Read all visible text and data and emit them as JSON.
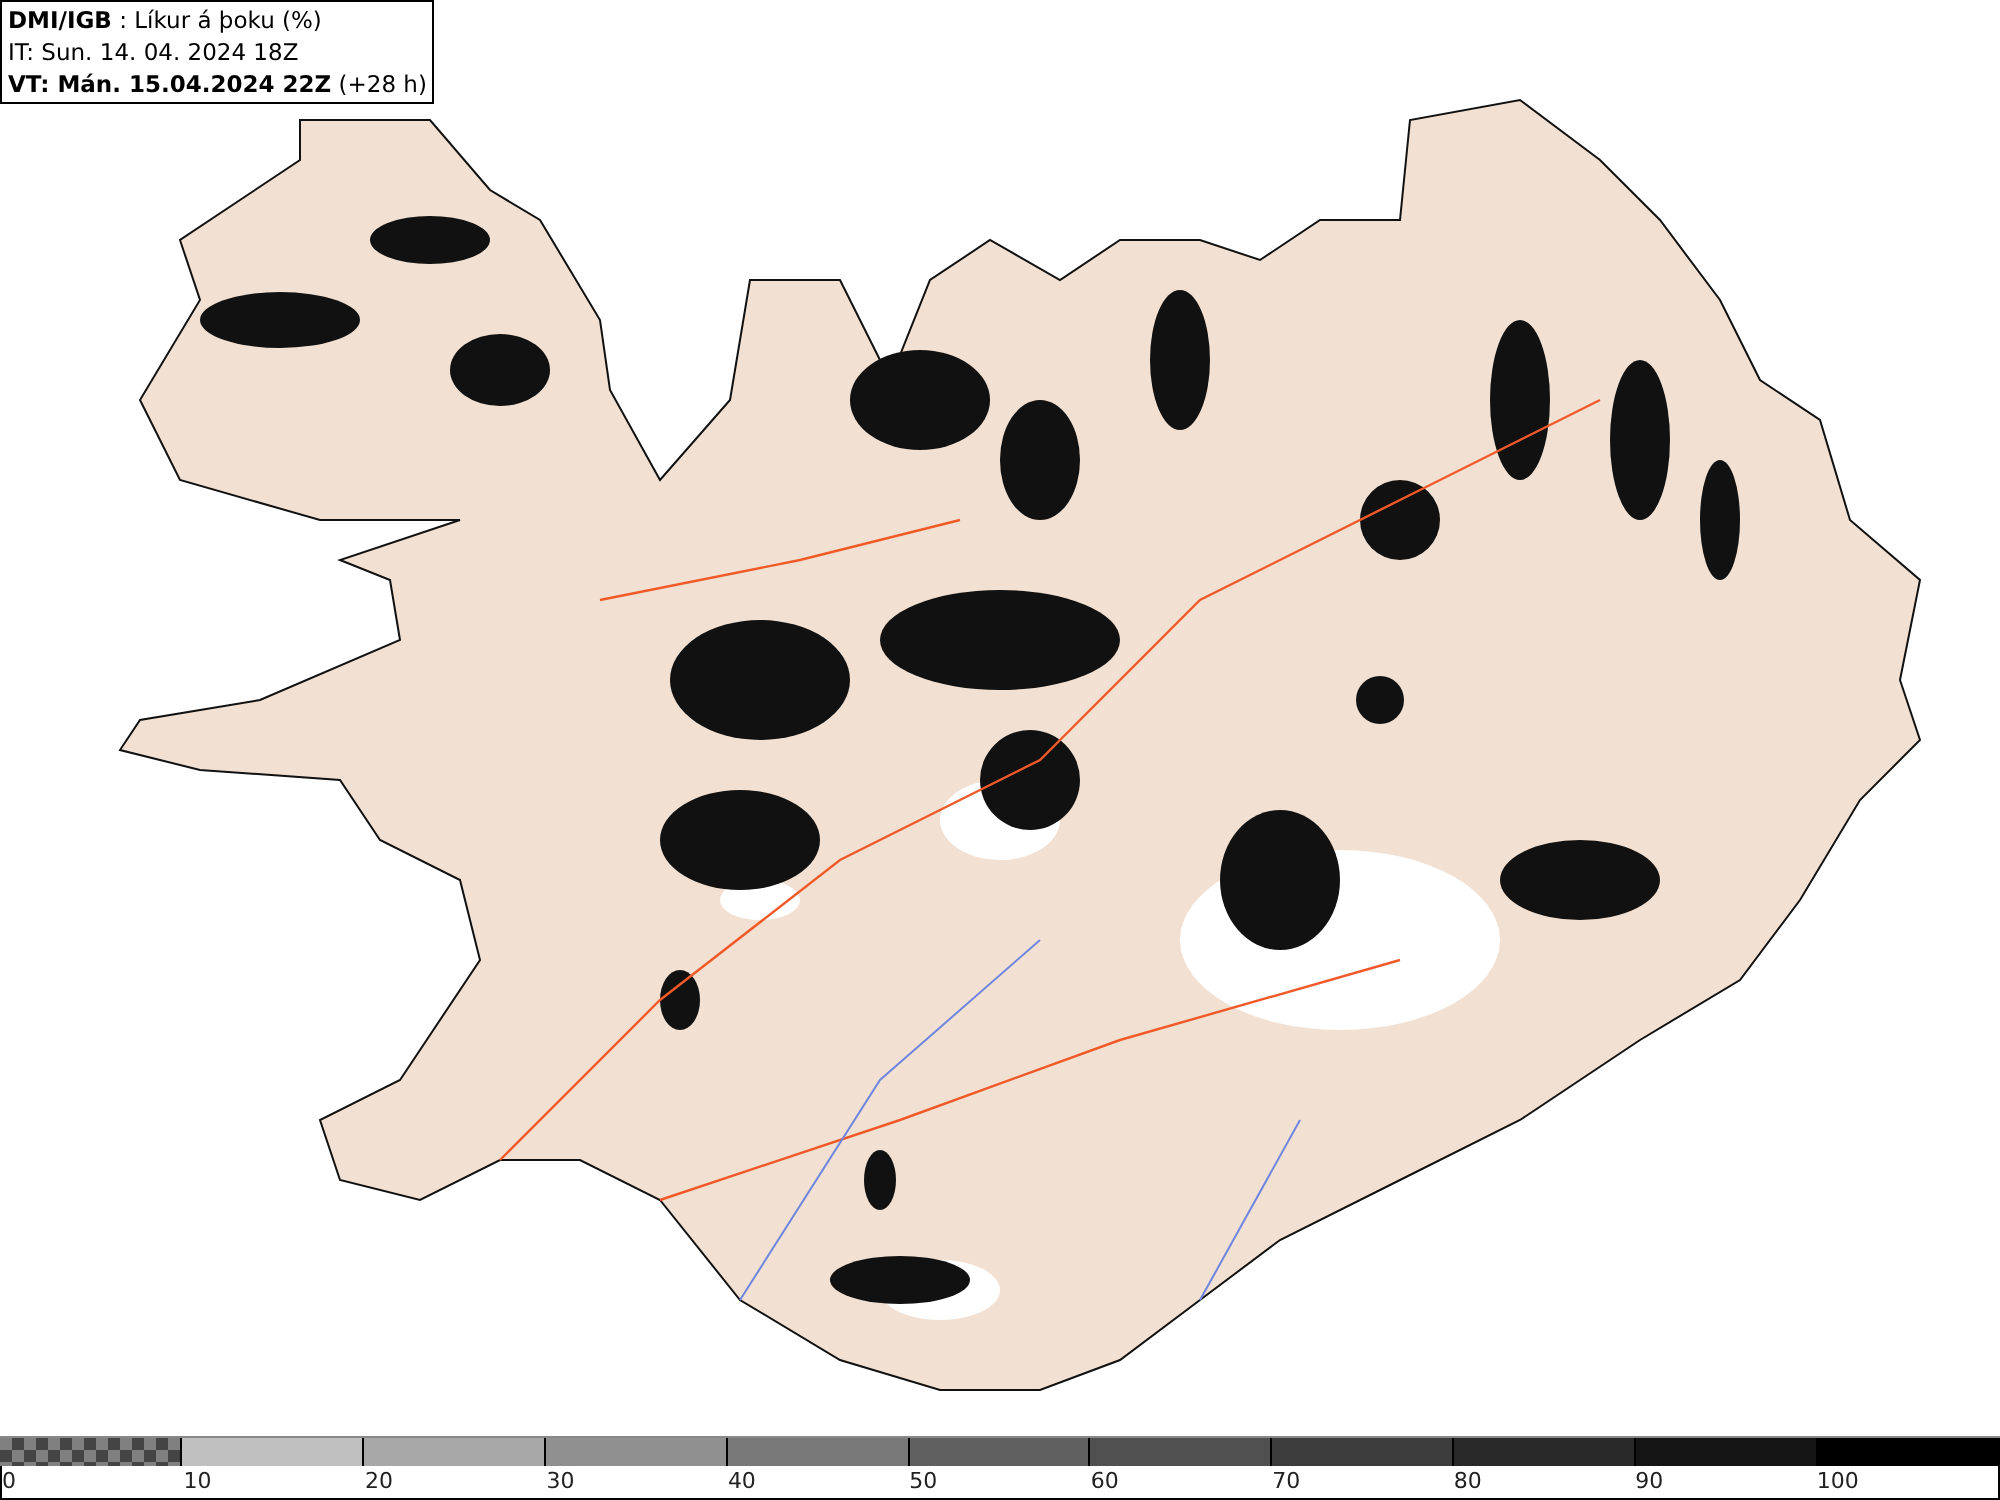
{
  "header": {
    "source": "DMI/IGB",
    "title": ": Líkur á þoku (%)",
    "issue_time": "IT: Sun. 14. 04. 2024 18Z",
    "valid_label": "VT: Mán. 15.04.2024 22Z",
    "valid_offset": "(+28 h)"
  },
  "legend": {
    "segments": [
      {
        "label": "0",
        "kind": "pattern",
        "color": "#808080"
      },
      {
        "label": "10",
        "kind": "solid",
        "color": "#c0c0c0"
      },
      {
        "label": "20",
        "kind": "solid",
        "color": "#a8a8a8"
      },
      {
        "label": "30",
        "kind": "solid",
        "color": "#909090"
      },
      {
        "label": "40",
        "kind": "solid",
        "color": "#787878"
      },
      {
        "label": "50",
        "kind": "solid",
        "color": "#606060"
      },
      {
        "label": "60",
        "kind": "solid",
        "color": "#505050"
      },
      {
        "label": "70",
        "kind": "solid",
        "color": "#3c3c3c"
      },
      {
        "label": "80",
        "kind": "solid",
        "color": "#282828"
      },
      {
        "label": "90",
        "kind": "solid",
        "color": "#141414"
      },
      {
        "label": "100",
        "kind": "solid",
        "color": "#000000"
      }
    ]
  }
}
